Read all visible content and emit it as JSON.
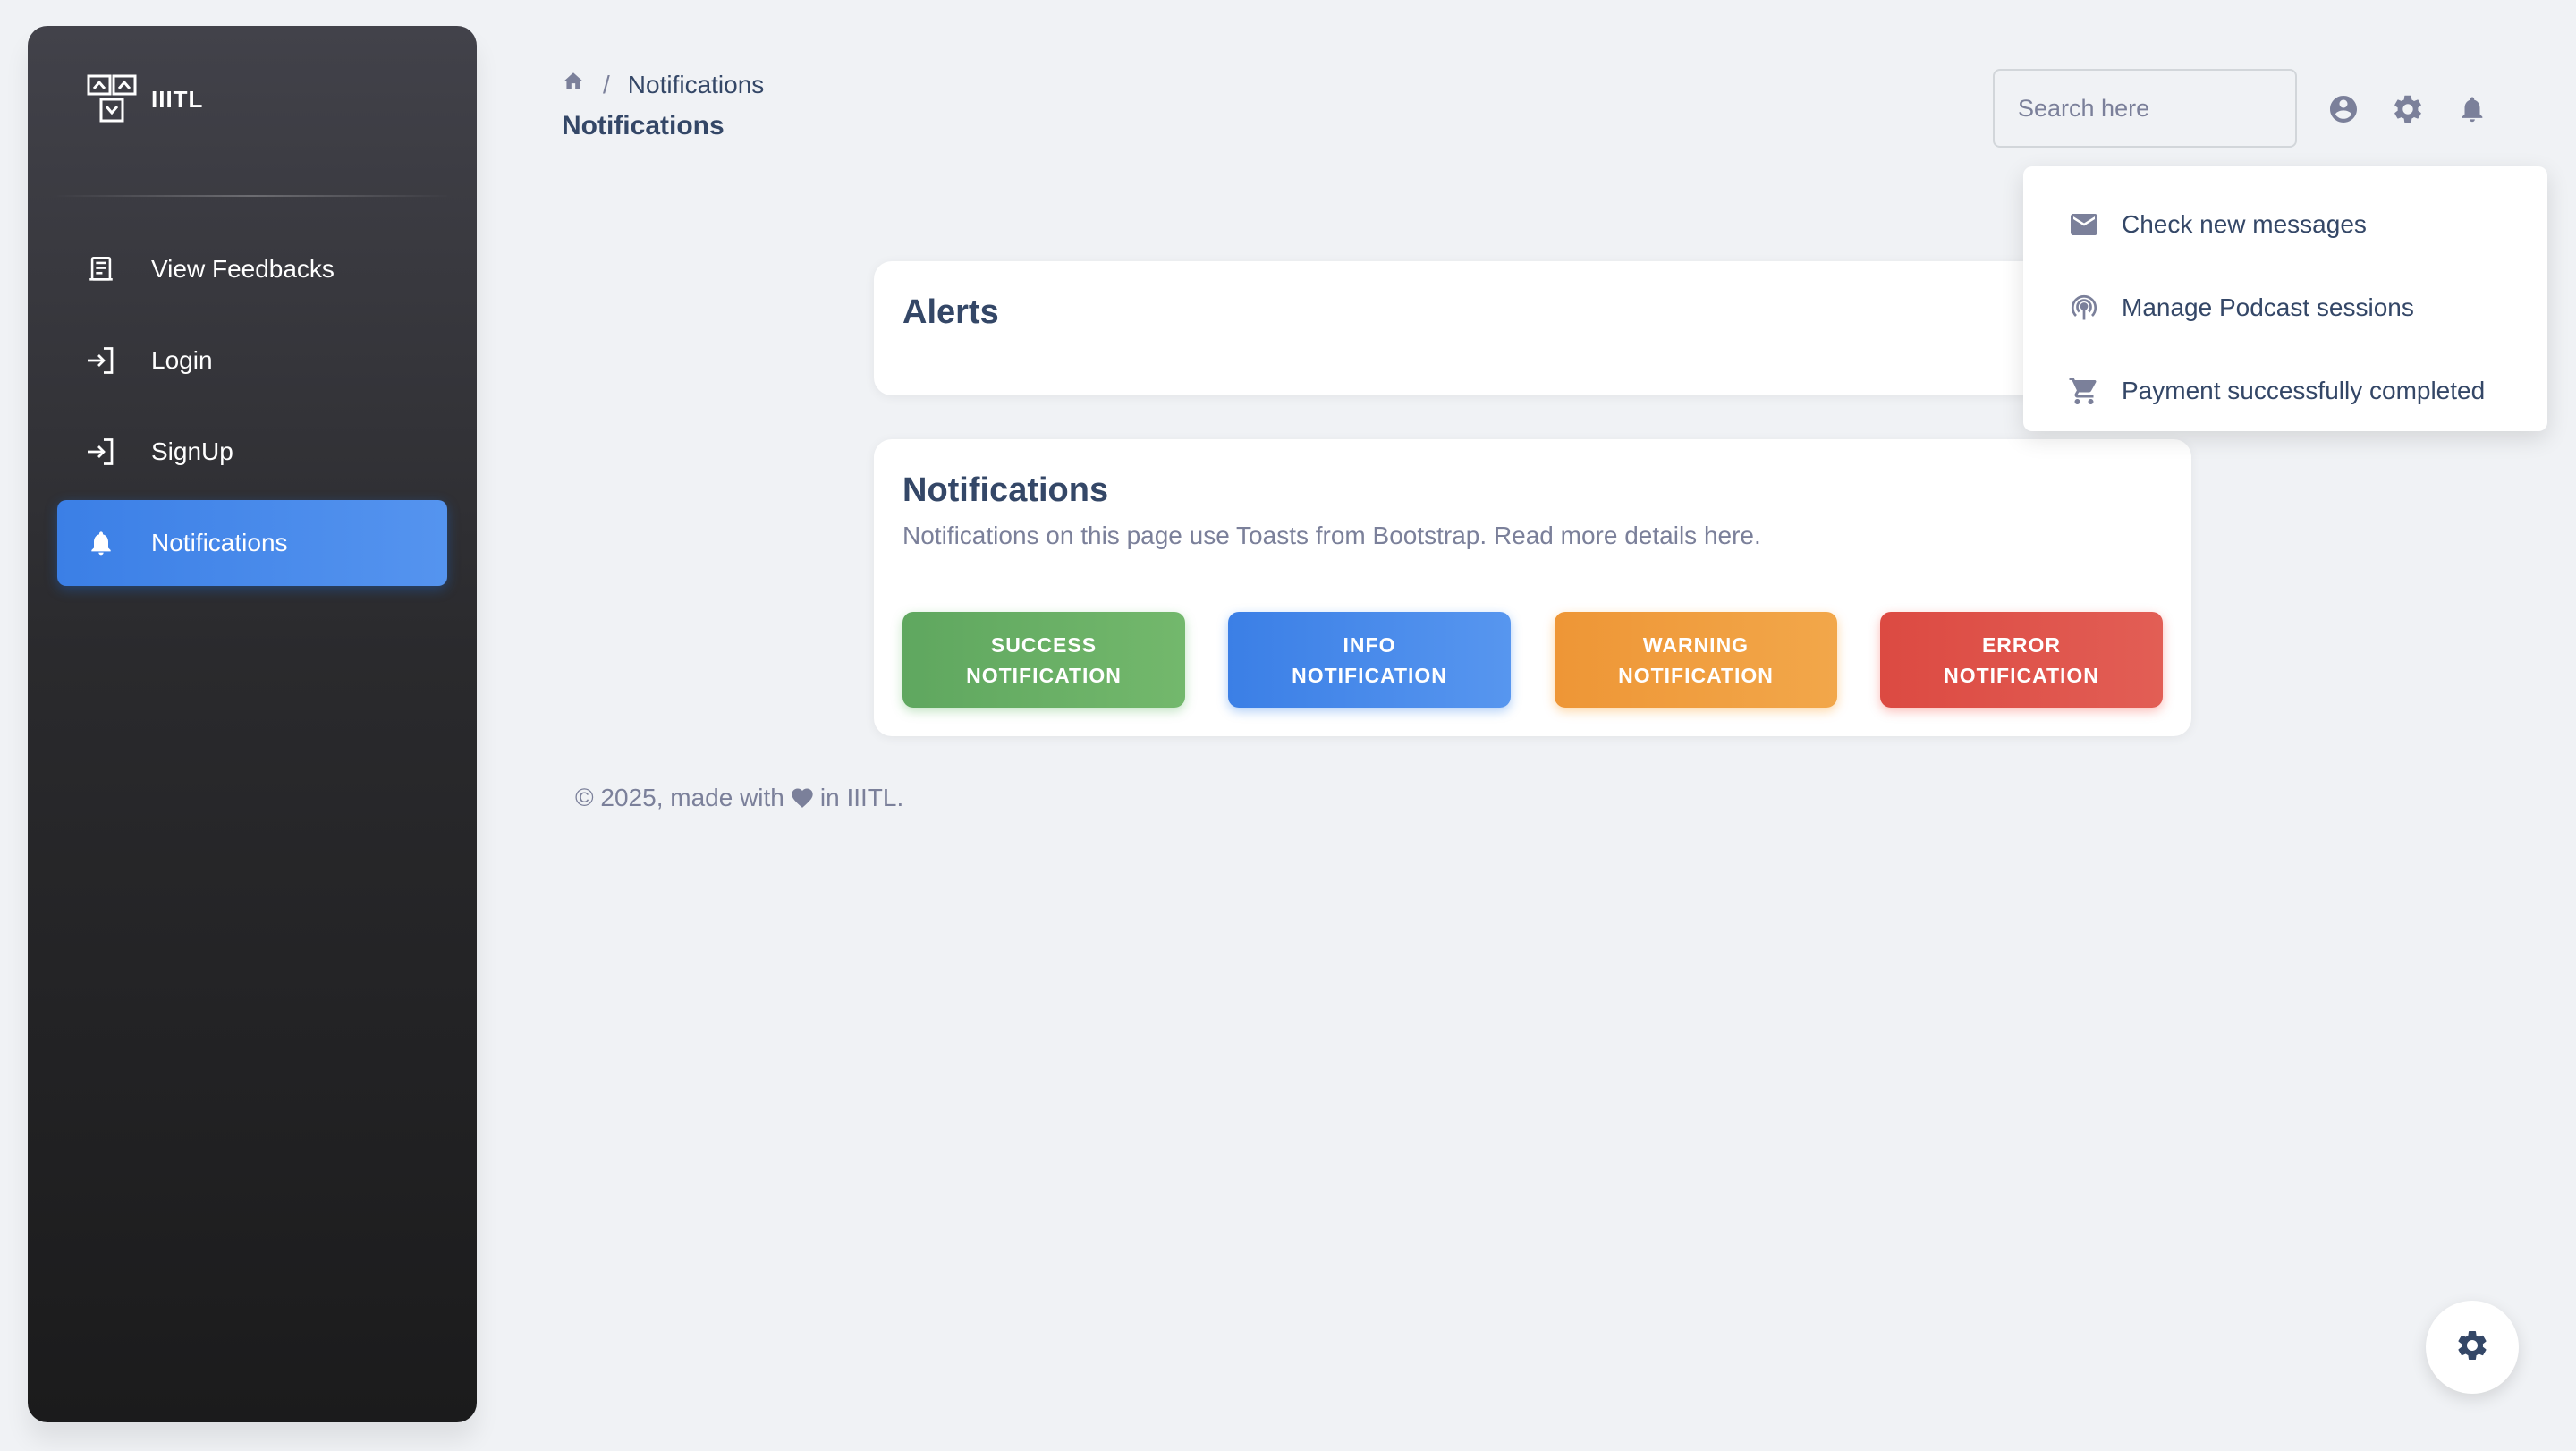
{
  "brand": {
    "name": "IIITL"
  },
  "sidebar": {
    "items": [
      {
        "label": "View Feedbacks",
        "icon": "receipt-icon"
      },
      {
        "label": "Login",
        "icon": "login-icon"
      },
      {
        "label": "SignUp",
        "icon": "signup-icon"
      },
      {
        "label": "Notifications",
        "icon": "bell-icon",
        "active": true
      }
    ]
  },
  "header": {
    "breadcrumb": {
      "home_icon": "home-icon",
      "separator": "/",
      "current": "Notifications"
    },
    "title": "Notifications",
    "search": {
      "placeholder": "Search here",
      "value": ""
    },
    "icons": [
      "account-circle-icon",
      "gear-icon",
      "bell-icon"
    ]
  },
  "dropdown": {
    "items": [
      {
        "label": "Check new messages",
        "icon": "email-icon"
      },
      {
        "label": "Manage Podcast sessions",
        "icon": "podcast-icon"
      },
      {
        "label": "Payment successfully completed",
        "icon": "shopping-cart-icon"
      }
    ]
  },
  "alerts_card": {
    "title": "Alerts"
  },
  "notifications_card": {
    "title": "Notifications",
    "description": "Notifications on this page use Toasts from Bootstrap. Read more details here.",
    "buttons": {
      "success": "SUCCESS\nNOTIFICATION",
      "info": "INFO\nNOTIFICATION",
      "warning": "WARNING\nNOTIFICATION",
      "error": "ERROR\nNOTIFICATION"
    }
  },
  "footer": {
    "prefix": "© 2025, made with",
    "suffix": "in IIITL.",
    "heart_icon": "heart-icon"
  },
  "fab": {
    "icon": "gear-icon"
  },
  "colors": {
    "accent": "#1a73e8",
    "success": "#4caf50",
    "info": "#1a73e8",
    "warning": "#fb8c00",
    "error": "#f44335",
    "text": "#344767",
    "muted": "#7b809a"
  }
}
